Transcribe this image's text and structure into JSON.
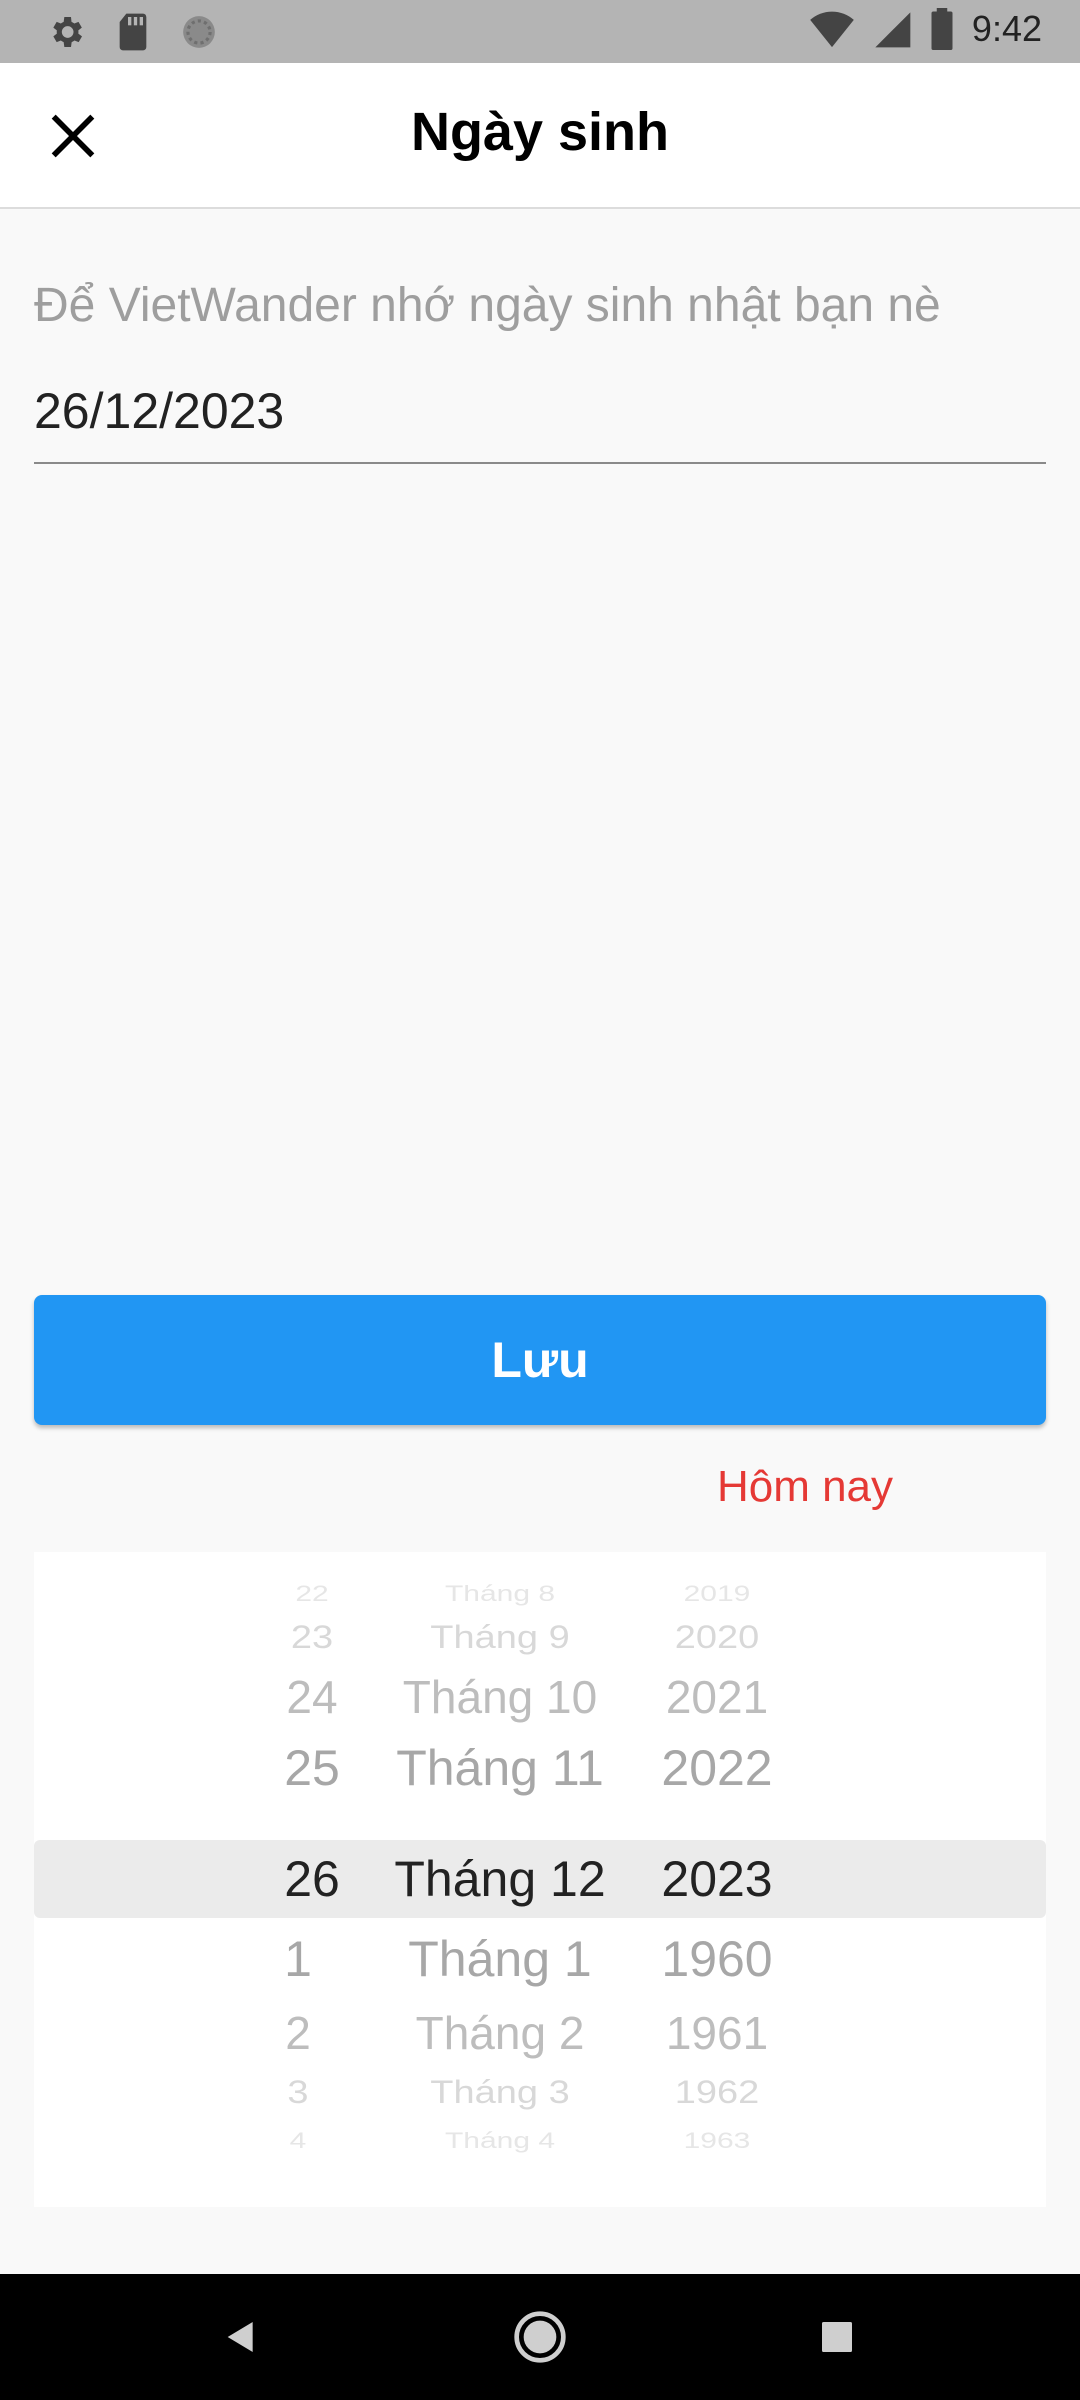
{
  "status_bar": {
    "time": "9:42",
    "left_icons": [
      "gear-icon",
      "sd-card-icon",
      "circle-icon"
    ],
    "right_icons": [
      "wifi-icon",
      "signal-icon",
      "battery-icon"
    ]
  },
  "app_bar": {
    "title": "Ngày sinh",
    "close_icon": "close-icon"
  },
  "field": {
    "label": "Để VietWander nhớ ngày sinh nhật bạn nè",
    "value": "26/12/2023"
  },
  "save_button": {
    "label": "Lưu"
  },
  "today_link": {
    "label": "Hôm nay"
  },
  "picker": {
    "selected": {
      "day": "26",
      "month": "Tháng 12",
      "year": "2023"
    },
    "rows": [
      {
        "day": "22",
        "month": "Tháng 8",
        "year": "2019"
      },
      {
        "day": "23",
        "month": "Tháng 9",
        "year": "2020"
      },
      {
        "day": "24",
        "month": "Tháng 10",
        "year": "2021"
      },
      {
        "day": "25",
        "month": "Tháng 11",
        "year": "2022"
      },
      {
        "day": "26",
        "month": "Tháng 12",
        "year": "2023"
      },
      {
        "day": "1",
        "month": "Tháng 1",
        "year": "1960"
      },
      {
        "day": "2",
        "month": "Tháng 2",
        "year": "1961"
      },
      {
        "day": "3",
        "month": "Tháng 3",
        "year": "1962"
      },
      {
        "day": "4",
        "month": "Tháng 4",
        "year": "1963"
      }
    ]
  },
  "nav_bar": {
    "icons": [
      "back-icon",
      "home-icon",
      "recents-icon"
    ]
  },
  "colors": {
    "accent": "#2196f3",
    "today": "#e53935",
    "status_bar": "#b4b4b4"
  }
}
